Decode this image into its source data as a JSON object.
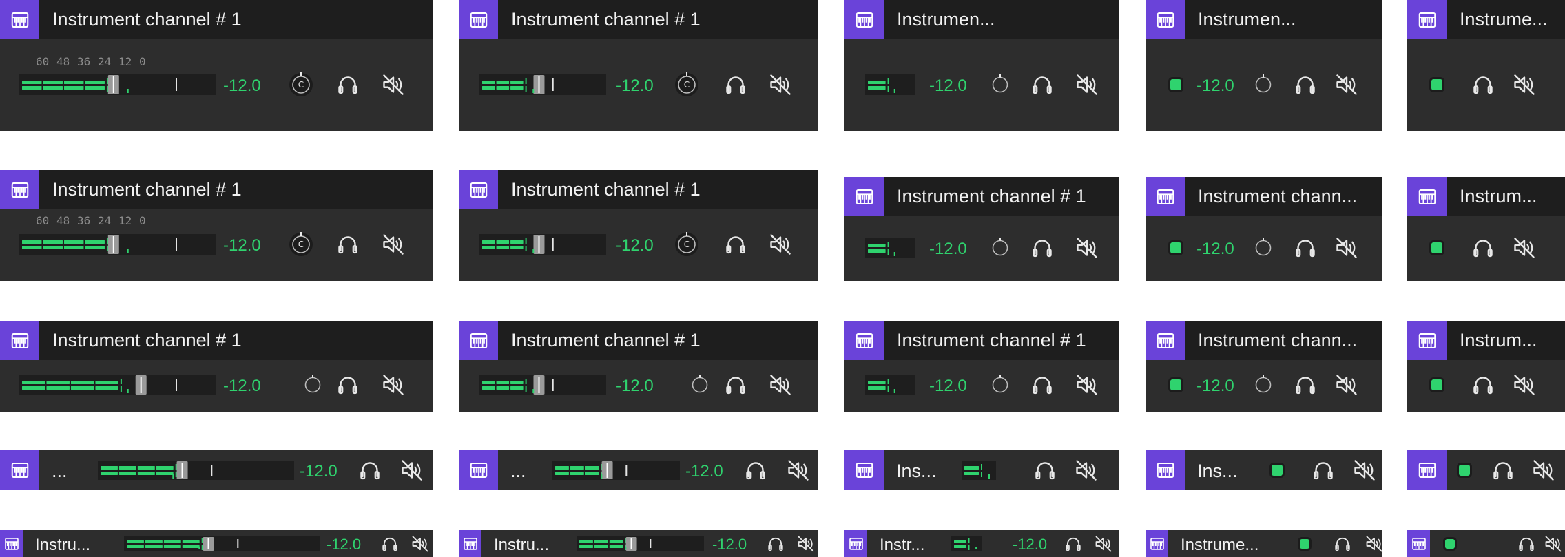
{
  "palette": {
    "accent": "#6a43d9",
    "level_green": "#2fd36e",
    "panel_bg": "#2d2d2d",
    "header_bg": "#1e1e1e",
    "text": "#f2f2f2",
    "icon_stroke": "#e8e8e8"
  },
  "icons": {
    "track": "piano-keys-icon",
    "pan": "pan-knob-icon",
    "solo": "headphones-icon",
    "mute": "speaker-muted-icon"
  },
  "scale_labels": [
    "60",
    "48",
    "36",
    "24",
    "12",
    "0"
  ],
  "pan_label": "C",
  "strips": [
    {
      "title": "Instrument channel # 1",
      "level_readout": "-12.0"
    },
    {
      "title": "Instrument channel # 1",
      "level_readout": "-12.0"
    },
    {
      "title": "Instrumen...",
      "level_readout": "-12.0"
    },
    {
      "title": "Instrumen...",
      "level_readout": "-12.0"
    },
    {
      "title": "Instrume..."
    },
    {
      "title": "Instrument channel # 1",
      "level_readout": "-12.0"
    },
    {
      "title": "Instrument channel # 1",
      "level_readout": "-12.0"
    },
    {
      "title": "Instrument channel # 1",
      "level_readout": "-12.0"
    },
    {
      "title": "Instrument chann...",
      "level_readout": "-12.0"
    },
    {
      "title": "Instrum..."
    },
    {
      "title": "Instrument channel # 1",
      "level_readout": "-12.0"
    },
    {
      "title": "Instrument channel # 1",
      "level_readout": "-12.0"
    },
    {
      "title": "Instrument channel # 1",
      "level_readout": "-12.0"
    },
    {
      "title": "Instrument chann...",
      "level_readout": "-12.0"
    },
    {
      "title": "Instrum..."
    },
    {
      "title": "...",
      "level_readout": "-12.0"
    },
    {
      "title": "...",
      "level_readout": "-12.0"
    },
    {
      "title": "Ins..."
    },
    {
      "title": "Ins..."
    },
    {
      "title": ""
    },
    {
      "title": "Instru...",
      "level_readout": "-12.0"
    },
    {
      "title": "Instru...",
      "level_readout": "-12.0"
    },
    {
      "title": "Instr...",
      "level_readout": "-12.0"
    },
    {
      "title": "Instrume..."
    },
    {
      "title": ""
    }
  ]
}
